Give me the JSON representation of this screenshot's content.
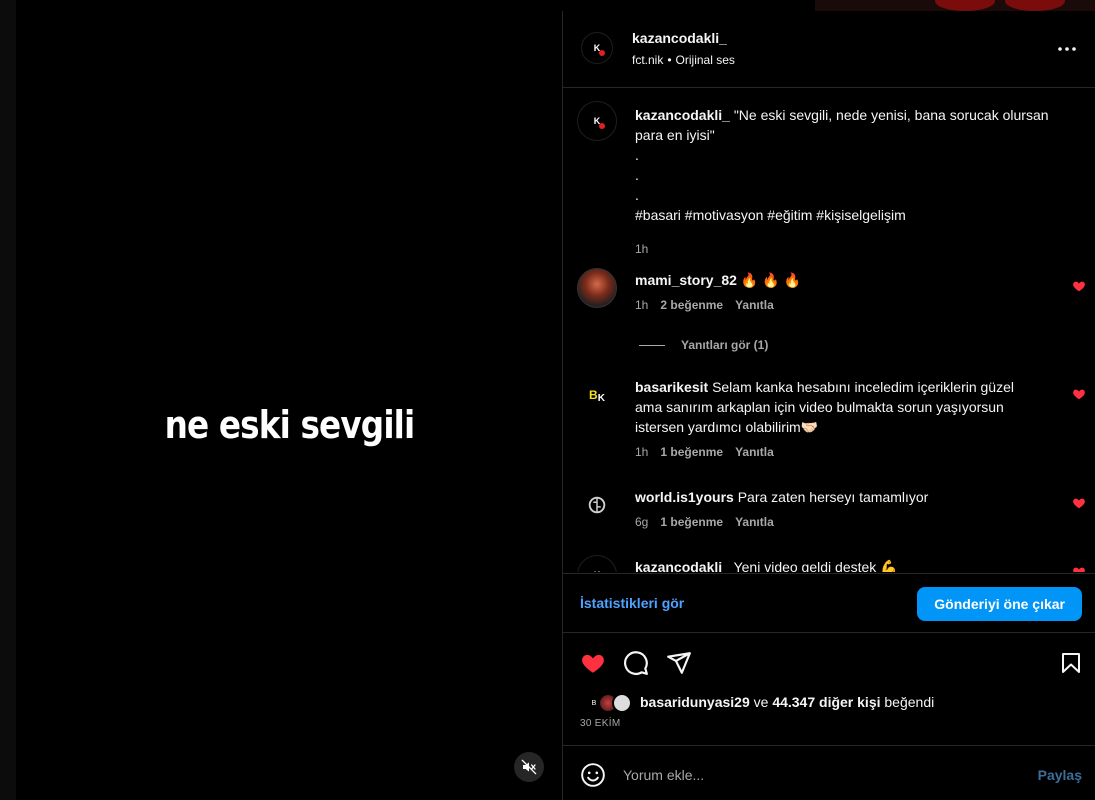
{
  "video": {
    "caption": "ne eski sevgili",
    "mute_icon": "speaker-muted-icon"
  },
  "header": {
    "username": "kazancodakli_",
    "audio_source": "fct.nik",
    "separator": "•",
    "audio_label": "Orijinal ses",
    "avatar_letter": "K"
  },
  "caption_post": {
    "username": "kazancodakli_",
    "text": "\"Ne eski sevgili, nede yenisi, bana sorucak olursan para en iyisi\"",
    "dots": [
      ".",
      ".",
      "."
    ],
    "hashtags": "#basari #motivasyon #eğitim #kişiselgelişim",
    "time": "1h"
  },
  "comments": [
    {
      "username": "mami_story_82",
      "text": "🔥 🔥 🔥",
      "time": "1h",
      "likes": "2 beğenme",
      "reply": "Yanıtla"
    },
    {
      "username": "basarikesit",
      "text": "Selam kanka hesabını inceledim içeriklerin güzel ama sanırım arkaplan için video bulmakta sorun yaşıyorsun istersen yardımcı olabilirim🤝🏻",
      "time": "1h",
      "likes": "1 beğenme",
      "reply": "Yanıtla",
      "avatar_text": "BK"
    },
    {
      "username": "world.is1yours",
      "text": "Para zaten herseyı tamamlıyor",
      "time": "6g",
      "likes": "1 beğenme",
      "reply": "Yanıtla"
    },
    {
      "username": "kazancodakli_",
      "text": "Yeni video geldi destek 💪"
    }
  ],
  "view_replies": "Yanıtları gör (1)",
  "stats": {
    "link": "İstatistikleri gör",
    "boost": "Gönderiyi öne çıkar"
  },
  "likes": {
    "user": "basaridunyasi29",
    "connector": "ve",
    "others": "44.347 diğer kişi",
    "suffix": "beğendi"
  },
  "date": "30 EKİM",
  "add_comment": {
    "placeholder": "Yorum ekle...",
    "share": "Paylaş"
  },
  "colors": {
    "like_red": "#ff3040",
    "primary_blue": "#0095f6",
    "link_blue": "#4da3ff",
    "muted_text": "#a8a8a8"
  }
}
